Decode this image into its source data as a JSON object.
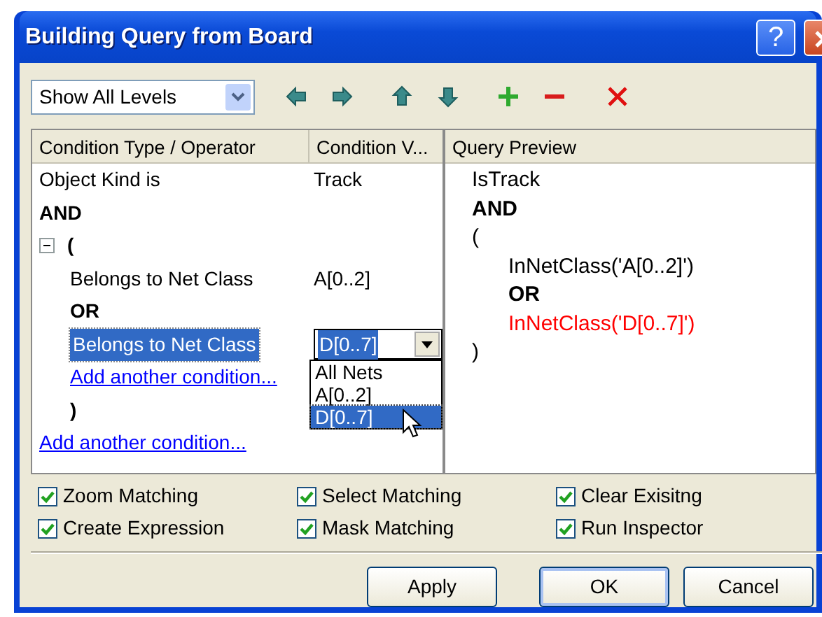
{
  "window": {
    "title": "Building Query from Board",
    "title_buttons": [
      {
        "kind": "help",
        "label": "?"
      },
      {
        "kind": "close"
      }
    ]
  },
  "toolbar": {
    "level_select": {
      "value": "Show All Levels"
    },
    "tools": [
      {
        "kind": "left"
      },
      {
        "kind": "right"
      },
      {
        "kind": "up"
      },
      {
        "kind": "down"
      },
      {
        "kind": "add"
      },
      {
        "kind": "remove"
      },
      {
        "kind": "delete"
      }
    ]
  },
  "conditions": {
    "columns": [
      "Condition Type / Operator",
      "Condition V..."
    ],
    "rows": [
      {
        "kind": "condition",
        "type": "Object Kind is",
        "value": "Track",
        "selected": false
      },
      {
        "kind": "operator",
        "text": "AND"
      },
      {
        "kind": "group",
        "open": "(",
        "close": ")",
        "expanded": true,
        "children": [
          {
            "kind": "condition",
            "type": "Belongs to Net Class",
            "value": "A[0..2]",
            "selected": false
          },
          {
            "kind": "operator",
            "text": "OR"
          },
          {
            "kind": "condition",
            "type": "Belongs to Net Class",
            "value": "D[0..7]",
            "selected": true,
            "dropdown": [
              {
                "label": "All Nets",
                "selected": false
              },
              {
                "label": "A[0..2]",
                "selected": false
              },
              {
                "label": "D[0..7]",
                "selected": true
              }
            ]
          },
          {
            "kind": "link",
            "text": "Add another condition..."
          }
        ]
      },
      {
        "kind": "link",
        "text": "Add another condition..."
      }
    ]
  },
  "query_preview": {
    "title": "Query Preview",
    "lines": [
      {
        "text": "IsTrack",
        "bold": false
      },
      {
        "text": "AND",
        "bold": true
      },
      {
        "text": "(",
        "bold": false,
        "children": [
          {
            "text": "InNetClass('A[0..2]')",
            "bold": false
          },
          {
            "text": "OR",
            "bold": true
          },
          {
            "text": "InNetClass('D[0..7]')",
            "bold": false,
            "color": "#ff0000"
          }
        ]
      },
      {
        "text": ")",
        "bold": false
      }
    ]
  },
  "options": [
    {
      "label": "Zoom Matching",
      "checked": true
    },
    {
      "label": "Select Matching",
      "checked": true
    },
    {
      "label": "Clear Exisitng",
      "checked": true
    },
    {
      "label": "Create Expression",
      "checked": true
    },
    {
      "label": "Mask Matching",
      "checked": true
    },
    {
      "label": "Run Inspector",
      "checked": true
    }
  ],
  "buttons": [
    {
      "label": "Apply",
      "default": false
    },
    {
      "label": "OK",
      "default": true
    },
    {
      "label": "Cancel",
      "default": false
    }
  ]
}
